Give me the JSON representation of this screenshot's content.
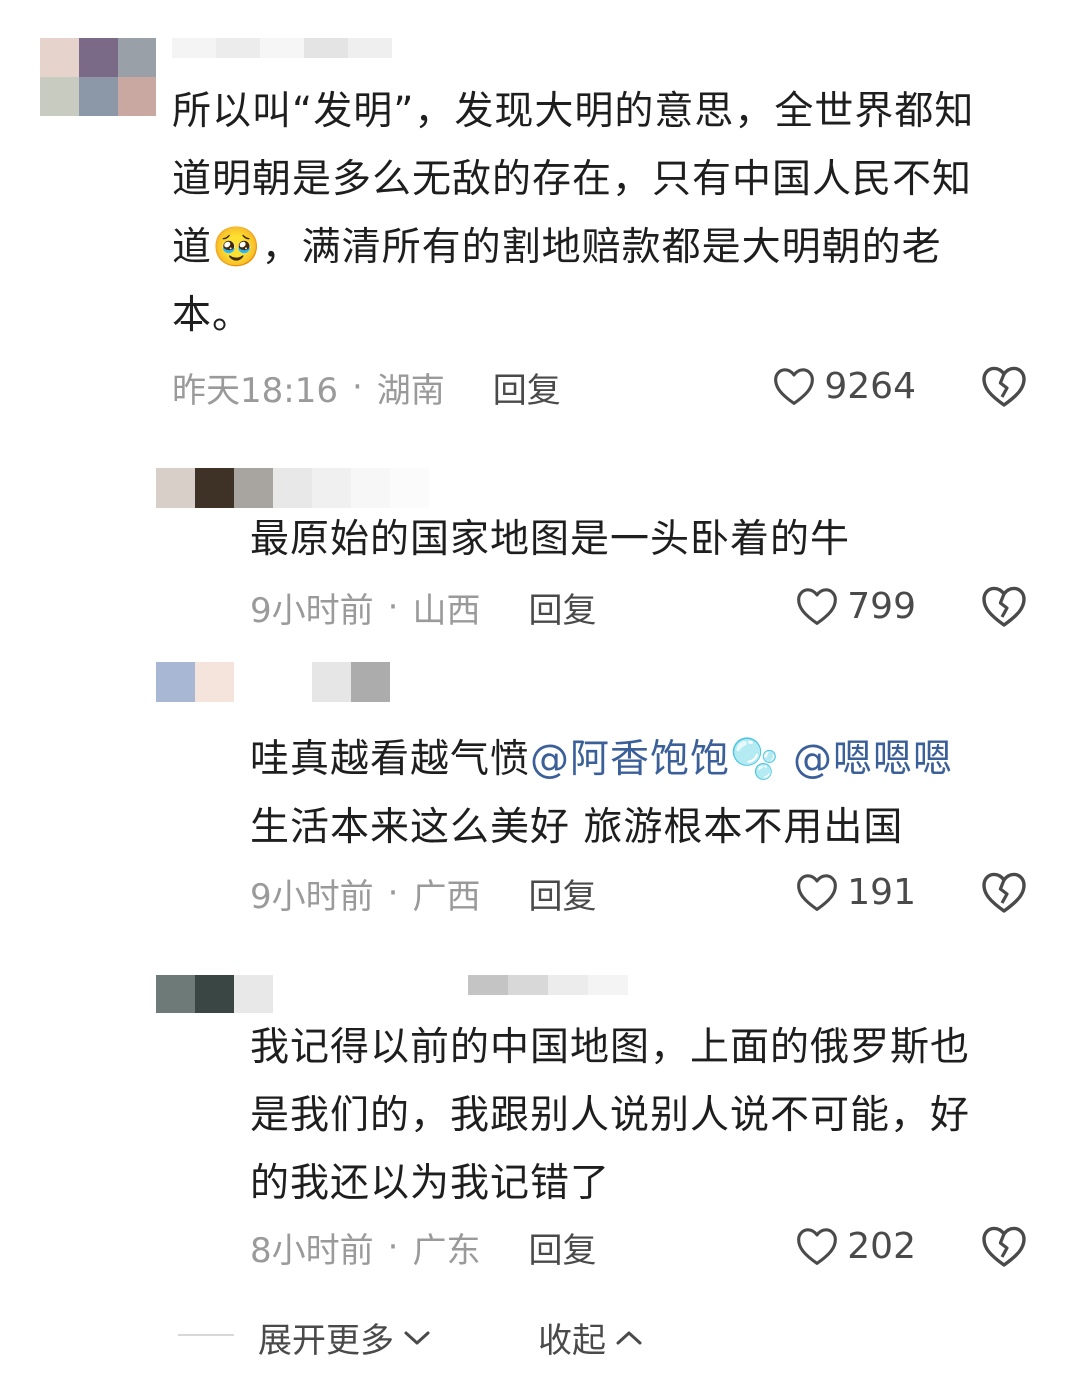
{
  "comments": [
    {
      "text_lines": [
        "所以叫“发明”，发现大明的意思，全世界都知",
        "道明朝是多么无敌的存在，只有中国人民不知"
      ],
      "text_line3_pre": "道",
      "emoji": "🥹",
      "text_line3_post": "，满清所有的割地赔款都是大明朝的老",
      "text_line4": "本。",
      "time": "昨天18:16",
      "location": "湖南",
      "reply": "回复",
      "likes": "9264"
    },
    {
      "text": "最原始的国家地图是一头卧着的牛",
      "time": "9小时前",
      "location": "山西",
      "reply": "回复",
      "likes": "799"
    },
    {
      "text_pre": "哇真越看越气愤",
      "mention1": "@阿香饱饱",
      "emoji": "🫧",
      "mention2": "@嗯嗯嗯",
      "text_line2": "生活本来这么美好 旅游根本不用出国",
      "time": "9小时前",
      "location": "广西",
      "reply": "回复",
      "likes": "191"
    },
    {
      "text_lines": [
        "我记得以前的中国地图，上面的俄罗斯也",
        "是我们的，我跟别人说别人说不可能，好",
        "的我还以为我记错了"
      ],
      "time": "8小时前",
      "location": "广东",
      "reply": "回复",
      "likes": "202"
    }
  ],
  "footer": {
    "expand": "展开更多",
    "collapse": "收起"
  },
  "icons": {
    "like": "heart-outline-icon",
    "dislike": "broken-heart-icon",
    "expand": "chevron-down-icon",
    "collapse": "chevron-up-icon"
  },
  "colors": {
    "text": "#1e1e1e",
    "meta": "#9a9a9a",
    "mention": "#3b5f99",
    "action": "#4a4a4a"
  }
}
